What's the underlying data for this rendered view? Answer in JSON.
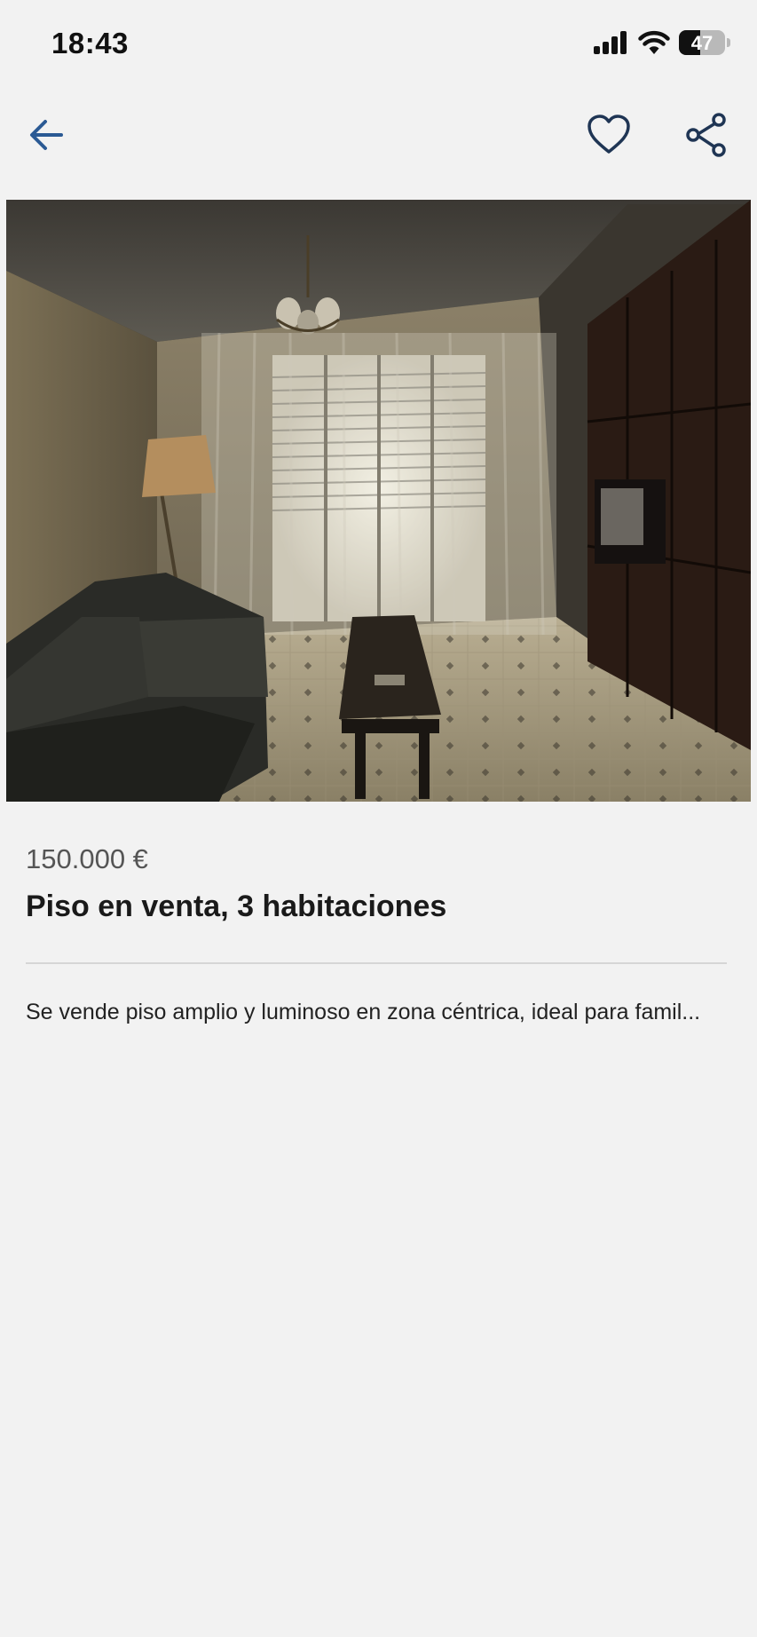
{
  "status_bar": {
    "time": "18:43",
    "battery_level": "47",
    "battery_percent": 47,
    "icons": [
      "signal-icon",
      "wifi-icon",
      "battery-icon"
    ]
  },
  "nav": {
    "icons": [
      "back-arrow-icon",
      "heart-icon",
      "share-icon"
    ],
    "accent_color": "#2b5a94",
    "icon_color": "#1f3554"
  },
  "listing": {
    "price": "150.000 €",
    "title": "Piso en venta, 3 habitaciones",
    "description": "Se vende piso amplio y luminoso en zona céntrica, ideal para famil..."
  }
}
